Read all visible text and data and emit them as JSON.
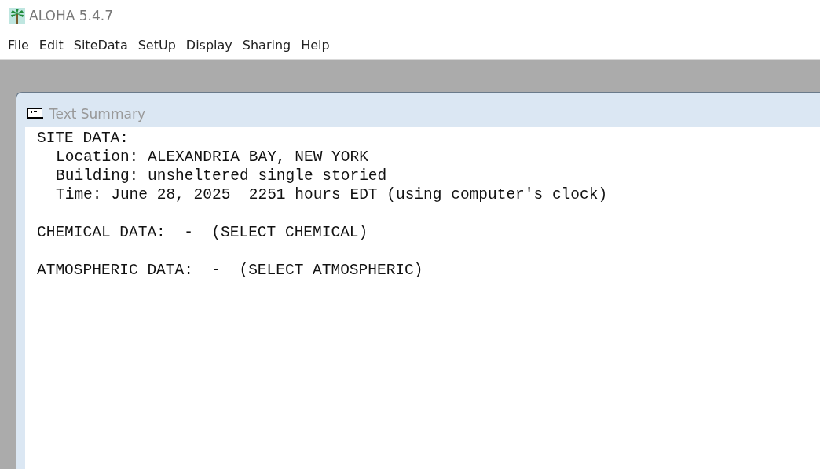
{
  "window": {
    "title": "ALOHA 5.4.7"
  },
  "menu": [
    "File",
    "Edit",
    "SiteData",
    "SetUp",
    "Display",
    "Sharing",
    "Help"
  ],
  "child_window": {
    "title": "Text Summary"
  },
  "sections": [
    {
      "heading": "SITE DATA:",
      "items": [
        "Location: ALEXANDRIA BAY, NEW YORK",
        "Building: unsheltered single storied",
        "Time: June 28, 2025  2251 hours EDT (using computer's clock)"
      ]
    },
    {
      "heading": "CHEMICAL DATA:  -  (SELECT CHEMICAL)"
    },
    {
      "heading": "ATMOSPHERIC DATA:  -  (SELECT ATMOSPHERIC)"
    }
  ]
}
